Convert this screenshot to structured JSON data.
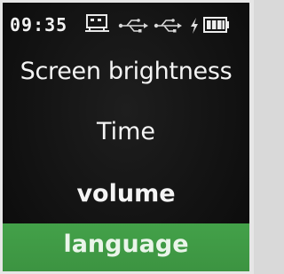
{
  "status_bar": {
    "time": "09:35",
    "icons": [
      "computer-icon",
      "usb-icon",
      "usb-icon",
      "charging-icon",
      "battery-icon"
    ]
  },
  "menu": {
    "items": [
      {
        "label": "Screen brightness",
        "selected": false
      },
      {
        "label": "Time",
        "selected": false
      },
      {
        "label": "volume",
        "selected": false
      },
      {
        "label": "language",
        "selected": true
      }
    ]
  },
  "colors": {
    "background": "#141414",
    "text": "#f4f4f4",
    "selection": "#3f9a45"
  }
}
